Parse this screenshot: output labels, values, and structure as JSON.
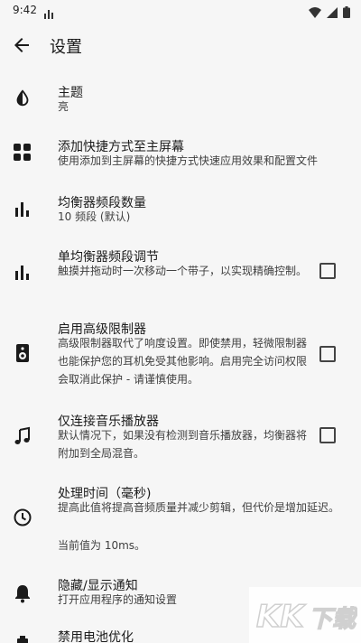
{
  "status_bar": {
    "time": "9:42"
  },
  "toolbar": {
    "title": "设置"
  },
  "settings": [
    {
      "title": "主题",
      "summary": "亮",
      "icon": "contrast-icon"
    },
    {
      "title": "添加快捷方式至主屏幕",
      "summary": "使用添加到主屏幕的快捷方式快速应用效果和配置文件",
      "icon": "widgets-icon"
    },
    {
      "title": "均衡器频段数量",
      "summary": "10 频段 (默认)",
      "icon": "bar-chart-icon"
    },
    {
      "title": "单均衡器频段调节",
      "summary": "触摸并拖动时一次移动一个带子，以实现精确控制。",
      "icon": "bar-chart-icon",
      "checked": false
    },
    {
      "title": "启用高级限制器",
      "summary": "高级限制器取代了响度设置。即使禁用，轻微限制器也能保护您的耳机免受其他影响。启用完全访问权限会取消此保护 - 请谨慎使用。",
      "icon": "speaker-icon",
      "checked": false
    },
    {
      "title": "仅连接音乐播放器",
      "summary": "默认情况下，如果没有检测到音乐播放器，均衡器将附加到全局混音。",
      "icon": "music-note-icon",
      "checked": false
    },
    {
      "title": "处理时间（毫秒)",
      "summary": "提高此值将提高音频质量并减少剪辑，但代价是增加延迟。",
      "summary2": "当前值为 10ms。",
      "icon": "clock-icon"
    },
    {
      "title": "隐藏/显示通知",
      "summary": "打开应用程序的通知设置",
      "icon": "bell-icon"
    },
    {
      "title": "禁用电池优化",
      "icon": "battery-icon"
    }
  ],
  "watermark": {
    "text": "KK下载"
  }
}
